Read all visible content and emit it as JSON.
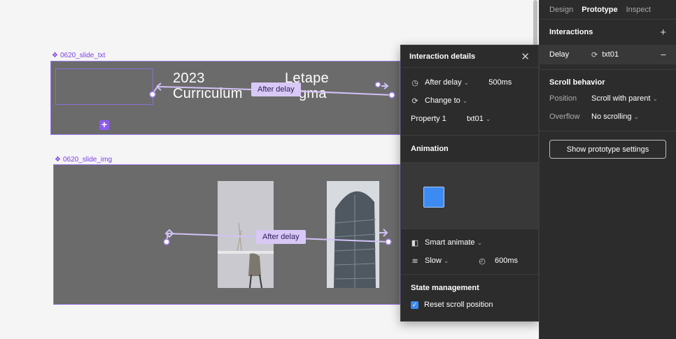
{
  "canvas": {
    "frame1_label": "0620_slide_txt",
    "frame2_label": "0620_slide_img",
    "slide1_text_line1": "2023",
    "slide1_text_line2": "Curriculum",
    "slide1_text_right1": "Letape",
    "slide1_text_right2": "gma",
    "connection1_label": "After delay",
    "connection2_label": "After delay",
    "frame_label_icon": "component-icon"
  },
  "interaction_panel": {
    "title": "Interaction details",
    "trigger_label": "After delay",
    "trigger_value": "500ms",
    "action_label": "Change to",
    "property_label": "Property 1",
    "property_value": "txt01",
    "animation_title": "Animation",
    "animation_type": "Smart animate",
    "easing": "Slow",
    "duration": "600ms",
    "state_title": "State management",
    "reset_scroll_label": "Reset scroll position",
    "reset_scroll_checked": true,
    "accent_color": "#3d8bf2"
  },
  "sidebar": {
    "tabs": [
      "Design",
      "Prototype",
      "Inspect"
    ],
    "active_tab": "Prototype",
    "interactions_title": "Interactions",
    "interaction_trigger": "Delay",
    "interaction_target": "txt01",
    "scroll_title": "Scroll behavior",
    "position_label": "Position",
    "position_value": "Scroll with parent",
    "overflow_label": "Overflow",
    "overflow_value": "No scrolling",
    "settings_button": "Show prototype settings"
  }
}
